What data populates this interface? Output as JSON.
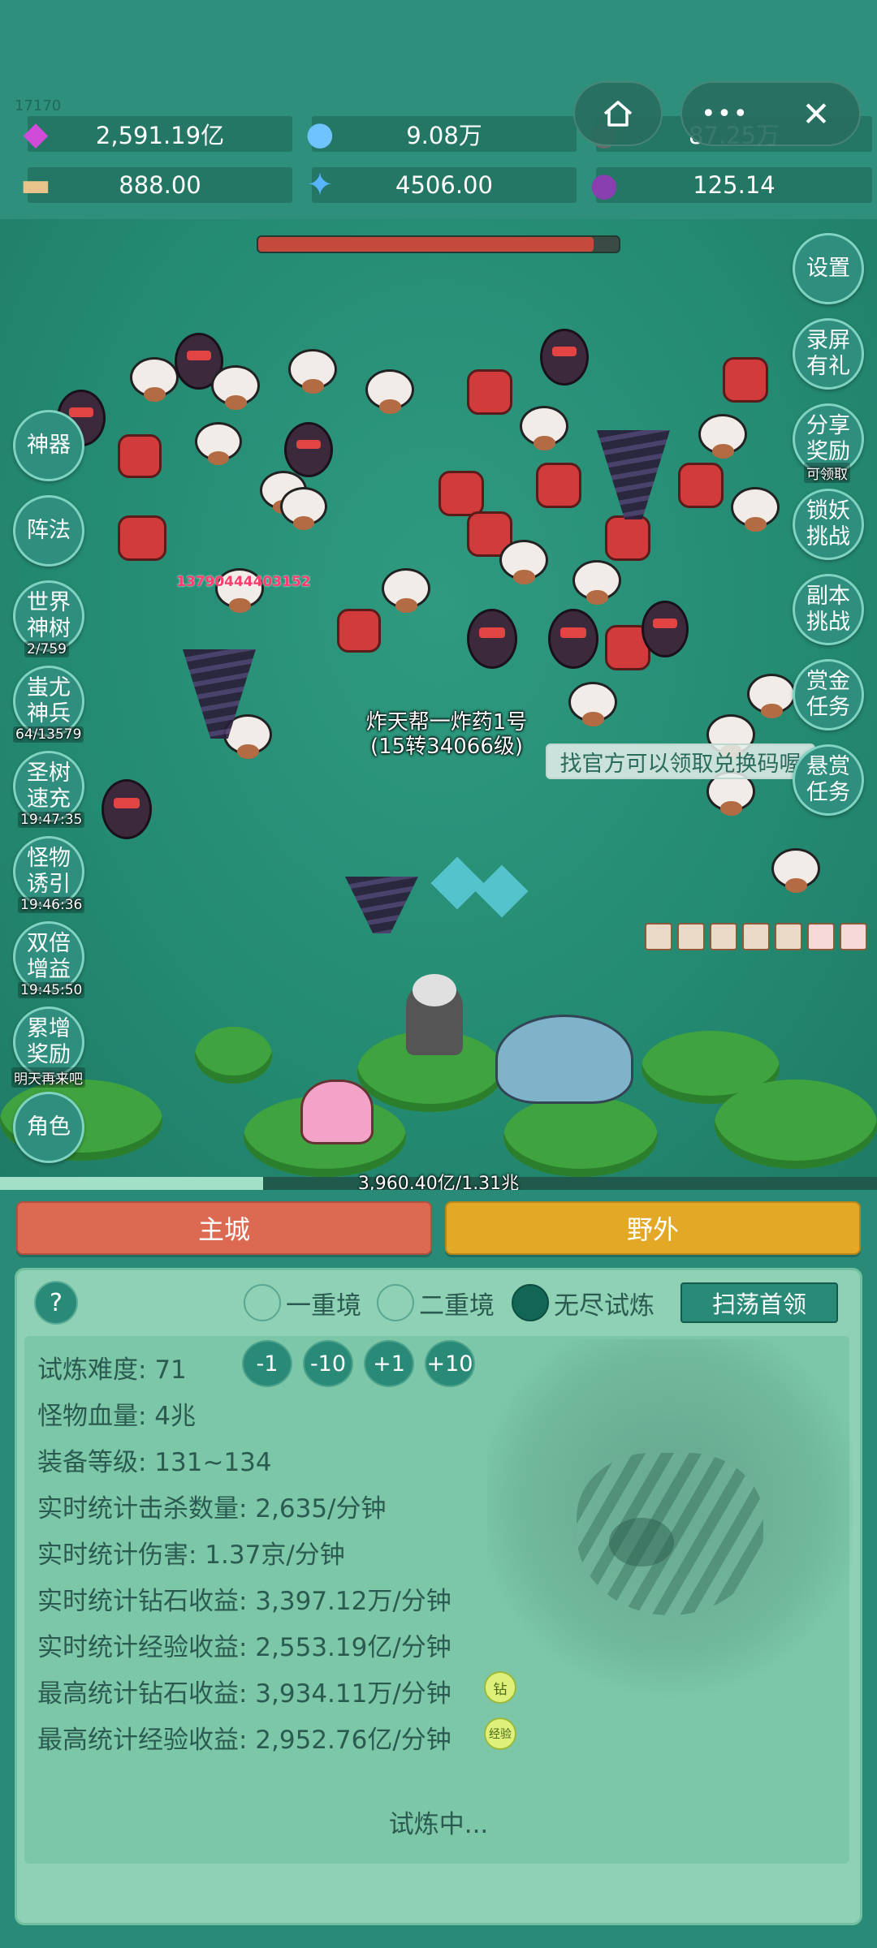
{
  "header": {
    "tiny_counter": "17170",
    "resources": [
      {
        "icon": "diamond-icon",
        "value": "2,591.19亿"
      },
      {
        "icon": "blue-orb-icon",
        "value": "9.08万"
      },
      {
        "icon": "coin-icon",
        "value": "87.25万"
      },
      {
        "icon": "scroll-icon",
        "value": "888.00"
      },
      {
        "icon": "blue-crystal-icon",
        "value": "4506.00"
      },
      {
        "icon": "purple-pot-icon",
        "value": "125.14"
      }
    ],
    "capsule_more": "•••",
    "capsule_close": "✕"
  },
  "left_buttons": [
    {
      "label": "神器",
      "sub": ""
    },
    {
      "label": "阵法",
      "sub": ""
    },
    {
      "label": "世界神树",
      "sub": "2/759"
    },
    {
      "label": "蚩尤神兵",
      "sub": "64/13579"
    },
    {
      "label": "圣树速充",
      "sub": "19:47:35"
    },
    {
      "label": "怪物诱引",
      "sub": "19:46:36"
    },
    {
      "label": "双倍增益",
      "sub": "19:45:50"
    },
    {
      "label": "累增奖励",
      "sub": "明天再来吧"
    },
    {
      "label": "角色",
      "sub": ""
    }
  ],
  "right_buttons": [
    {
      "label": "设置",
      "sub": ""
    },
    {
      "label": "录屏有礼",
      "sub": ""
    },
    {
      "label": "分享奖励",
      "sub": "可领取"
    },
    {
      "label": "锁妖挑战",
      "sub": ""
    },
    {
      "label": "副本挑战",
      "sub": ""
    },
    {
      "label": "赏金任务",
      "sub": ""
    },
    {
      "label": "悬赏任务",
      "sub": ""
    }
  ],
  "battle": {
    "damage_text": "13790444403152",
    "hero_name": "炸天帮一炸药1号",
    "hero_level": "(15转34066级)",
    "tip": "找官方可以领取兑换码喔",
    "boss_hp": 0.93,
    "exp_progress": 0.3,
    "exp_text": "3,960.40亿/1.31兆"
  },
  "tabs": {
    "main_city": "主城",
    "field": "野外"
  },
  "panel": {
    "help": "?",
    "modes": [
      {
        "label": "一重境",
        "selected": false
      },
      {
        "label": "二重境",
        "selected": false
      },
      {
        "label": "无尽试炼",
        "selected": true
      }
    ],
    "sweep_button": "扫荡首领",
    "difficulty_label": "试炼难度:",
    "difficulty_value": "71",
    "steps": [
      "-1",
      "-10",
      "+1",
      "+10"
    ],
    "stats": [
      "怪物血量: 4兆",
      "装备等级: 131~134",
      "实时统计击杀数量: 2,635/分钟",
      "实时统计伤害: 1.37京/分钟",
      "实时统计钻石收益: 3,397.12万/分钟",
      "实时统计经验收益: 2,553.19亿/分钟",
      "最高统计钻石收益: 3,934.11万/分钟",
      "最高统计经验收益: 2,952.76亿/分钟"
    ],
    "badge_diamond": "钻",
    "badge_exp": "经验",
    "status": "试炼中..."
  }
}
